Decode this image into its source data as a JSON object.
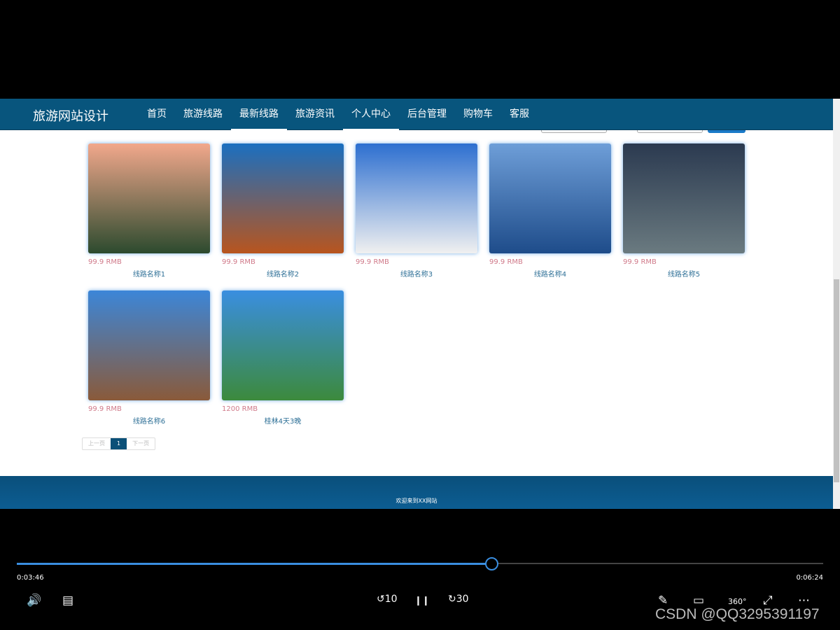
{
  "site": {
    "brand": "旅游网站设计",
    "nav": [
      "首页",
      "旅游线路",
      "最新线路",
      "旅游资讯",
      "个人中心",
      "后台管理",
      "购物车",
      "客服"
    ],
    "active_nav": [
      2,
      4
    ],
    "routes": [
      {
        "price": "99.9 RMB",
        "name": "线路名称1",
        "colors": [
          "#f2a88c",
          "#2c4a2e"
        ]
      },
      {
        "price": "99.9 RMB",
        "name": "线路名称2",
        "colors": [
          "#1a6fc0",
          "#b8551e"
        ]
      },
      {
        "price": "99.9 RMB",
        "name": "线路名称3",
        "colors": [
          "#2d6fd0",
          "#f0f0f0"
        ]
      },
      {
        "price": "99.9 RMB",
        "name": "线路名称4",
        "colors": [
          "#6e9ed8",
          "#1e4c8a"
        ]
      },
      {
        "price": "99.9 RMB",
        "name": "线路名称5",
        "colors": [
          "#2b3a50",
          "#6a7a80"
        ]
      },
      {
        "price": "99.9 RMB",
        "name": "线路名称6",
        "colors": [
          "#3c86d8",
          "#8a5a3a"
        ]
      },
      {
        "price": "1200 RMB",
        "name": "桂林4天3晚",
        "colors": [
          "#3a8ee0",
          "#3c8a3c"
        ]
      }
    ],
    "pager": {
      "prev": "上一页",
      "current": "1",
      "next": "下一页"
    },
    "footer": "欢迎来到XX网站"
  },
  "player": {
    "elapsed": "0:03:46",
    "duration": "0:06:24",
    "progress_percent": 58.9,
    "accent": "#3a8ee0",
    "controls": {
      "volume": "🔊",
      "captions": "▤",
      "rewind": "↺10",
      "pause": "❙❙",
      "forward": "↻30",
      "draw": "✎",
      "miniview": "▭",
      "vr": "360°",
      "fullscreen": "⤢",
      "more": "⋯"
    }
  },
  "watermark": "CSDN @QQ3295391197"
}
